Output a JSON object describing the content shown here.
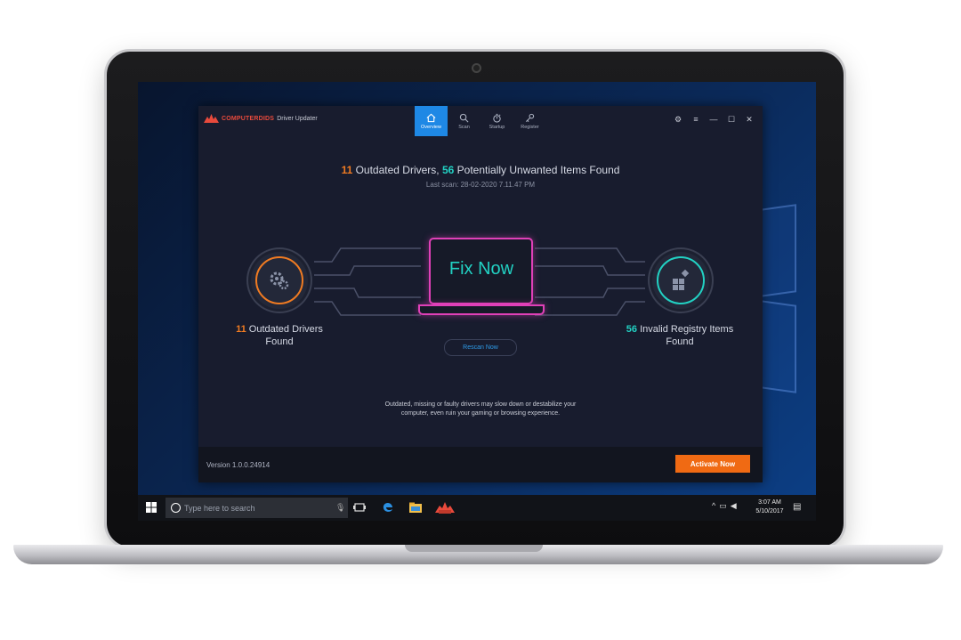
{
  "app": {
    "brand_name": "COMPUTERDIDS",
    "brand_product": "Driver Updater",
    "nav": [
      {
        "label": "Overview",
        "active": true
      },
      {
        "label": "Scan",
        "active": false
      },
      {
        "label": "Startup",
        "active": false
      },
      {
        "label": "Register",
        "active": false
      }
    ],
    "headline": {
      "outdated_count": "11",
      "outdated_text": " Outdated Drivers, ",
      "unwanted_count": "56",
      "unwanted_text": " Potentially Unwanted Items Found"
    },
    "last_scan": "Last scan: 28-02-2020 7.11.47 PM",
    "left_panel": {
      "count": "11",
      "line1": " Outdated Drivers",
      "line2": "Found"
    },
    "right_panel": {
      "count": "56",
      "line1": " Invalid Registry Items",
      "line2": "Found"
    },
    "fix_now_label": "Fix Now",
    "rescan_label": "Rescan Now",
    "note_line1": "Outdated, missing or faulty drivers may slow down or destabilize your",
    "note_line2": "computer, even ruin your gaming or browsing experience.",
    "version": "Version 1.0.0.24914",
    "activate_label": "Activate Now",
    "colors": {
      "accent_orange": "#f07b22",
      "accent_teal": "#22d1c3",
      "nav_active": "#1e88e5",
      "laptop_glow": "#e040b8",
      "activate": "#f06a13"
    }
  },
  "taskbar": {
    "search_placeholder": "Type here to search",
    "time": "3:07 AM",
    "date": "5/10/2017",
    "icons": [
      "windows-start-icon",
      "task-view-icon",
      "edge-browser-icon",
      "file-explorer-icon",
      "driver-updater-app-icon"
    ]
  }
}
